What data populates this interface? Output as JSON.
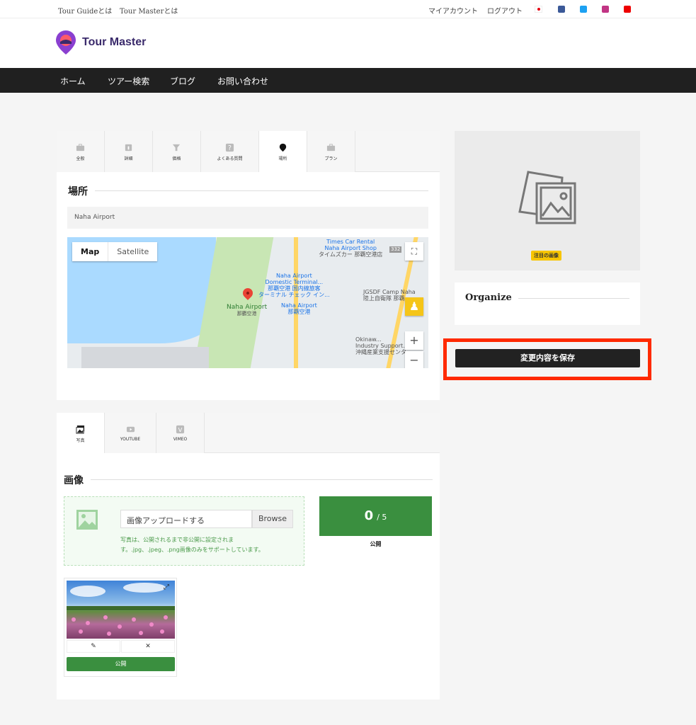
{
  "topbar": {
    "links": [
      "Tour Guideとは",
      "Tour Masterとは"
    ],
    "account": "マイアカウント",
    "logout": "ログアウト"
  },
  "header": {
    "logo_text": "Tour Master"
  },
  "nav": {
    "items": [
      "ホーム",
      "ツアー検索",
      "ブログ",
      "お問い合わせ"
    ]
  },
  "tour_tabs": [
    {
      "label": "全般",
      "icon": "briefcase-icon"
    },
    {
      "label": "詳細",
      "icon": "info-icon"
    },
    {
      "label": "価格",
      "icon": "price-tag-icon"
    },
    {
      "label": "よくある質問",
      "icon": "question-icon"
    },
    {
      "label": "場所",
      "icon": "map-pin-icon"
    },
    {
      "label": "プラン",
      "icon": "briefcase-icon"
    }
  ],
  "location": {
    "title": "場所",
    "input_value": "Naha Airport",
    "map": {
      "type_map": "Map",
      "type_satellite": "Satellite",
      "labels": {
        "times_car": "Times Car Rental",
        "naha_shop": "Naha Airport Shop",
        "times_jp": "タイムズカー 那覇空港店",
        "domestic": "Naha Airport",
        "domestic2": "Domestic Terminal...",
        "domestic_jp": "那覇空港 国内線旅客",
        "domestic_jp2": "ターミナル チェック イン...",
        "pin_label": "Naha Airport",
        "pin_label_jp": "那覇空港",
        "station": "Naha Airport",
        "station_jp": "那覇空港",
        "jgsdf": "JGSDF Camp Naha",
        "jgsdf_jp": "陸上自衛隊 那覇...",
        "okinawa": "Okinaw...",
        "okinawa2": "Industry Support...",
        "okinawa_jp": "沖縄産業支援センター",
        "route": "332"
      }
    }
  },
  "media_tabs": [
    {
      "label": "写真",
      "icon": "photos-icon"
    },
    {
      "label": "YOUTUBE",
      "icon": "youtube-icon"
    },
    {
      "label": "VIMEO",
      "icon": "vimeo-icon"
    }
  ],
  "images": {
    "title": "画像",
    "upload_placeholder": "画像アップロードする",
    "browse": "Browse",
    "note_line1": "写真は、公開されるまで非公開に設定されま",
    "note_line2": "す。.jpg、.jpeg、.png画像のみをサポートしています。",
    "count": "0",
    "max": "/ 5",
    "count_label": "公開",
    "thumb_publish": "公開",
    "thumb_edit_icon": "pencil-icon",
    "thumb_delete_icon": "close-icon"
  },
  "sidebar": {
    "featured_badge": "注目の画像",
    "organize_title": "Organize",
    "save_button": "変更内容を保存"
  },
  "colors": {
    "nav_bg": "#202020",
    "green": "#3a8f3f",
    "highlight": "#ff2a00",
    "badge": "#f7c500"
  }
}
